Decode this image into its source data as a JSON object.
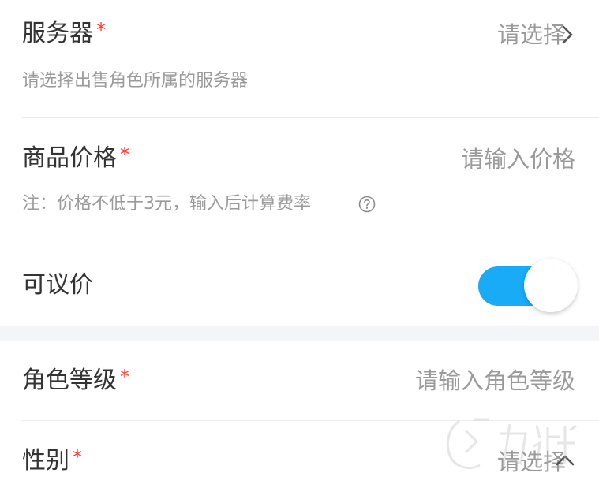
{
  "colors": {
    "accent": "#1aabf7",
    "required": "#ff3b30",
    "label": "#333333",
    "placeholder": "#9a9a9a",
    "divider": "#ececec",
    "section_gap": "#f4f5f8"
  },
  "required_mark": "*",
  "server": {
    "label": "服务器",
    "value": "请选择",
    "hint": "请选择出售角色所属的服务器"
  },
  "price": {
    "label": "商品价格",
    "placeholder": "请输入价格",
    "hint": "注：价格不低于3元，输入后计算费率",
    "help_icon": "question-circle-icon"
  },
  "negotiable": {
    "label": "可议价",
    "enabled": true
  },
  "level": {
    "label": "角色等级",
    "placeholder": "请输入角色等级"
  },
  "gender": {
    "label": "性别",
    "value": "请选择"
  },
  "watermark": {
    "text": "九游"
  }
}
